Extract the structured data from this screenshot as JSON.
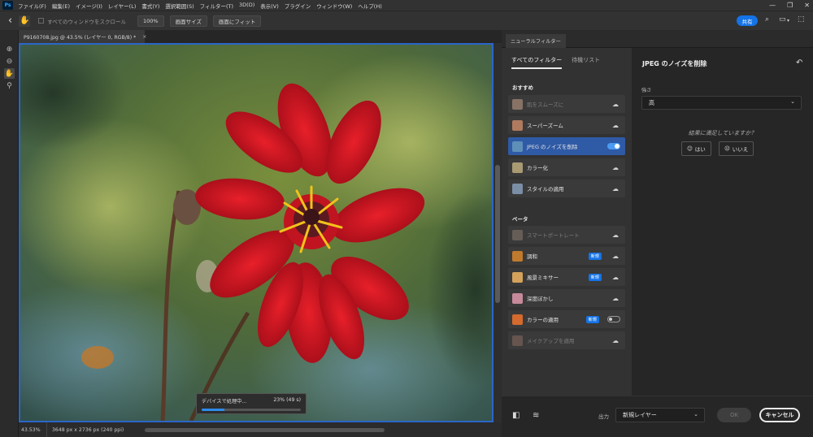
{
  "app": {
    "logo": "Ps"
  },
  "menu": [
    "ファイル(F)",
    "編集(E)",
    "イメージ(I)",
    "レイヤー(L)",
    "書式(Y)",
    "選択範囲(S)",
    "フィルター(T)",
    "3D(D)",
    "表示(V)",
    "プラグイン",
    "ウィンドウ(W)",
    "ヘルプ(H)"
  ],
  "window_controls": {
    "minimize": "—",
    "restore": "❐",
    "close": "✕"
  },
  "options": {
    "back_icon": "chevron-left-icon",
    "scroll_all_label": "すべてのウィンドウをスクロール",
    "zoom_100": "100%",
    "fit_screen": "画面サイズ",
    "fill_screen": "画面にフィット",
    "share": "共有"
  },
  "document": {
    "tab_title": "P9160708.jpg @ 43.5% (レイヤー 0, RGB/8) *",
    "tab_close": "×",
    "zoom": "43.53%",
    "size_info": "3648 px x 2736 px (240 ppi)"
  },
  "progress": {
    "label": "デバイスで処理中...",
    "value_text": "23% (49 s)",
    "percent": 23
  },
  "neural_filters": {
    "panel_tab": "ニューラルフィルター",
    "tabs": [
      "すべてのフィルター",
      "待機リスト"
    ],
    "section_featured": "おすすめ",
    "section_beta": "ベータ",
    "featured": [
      {
        "label": "肌をスムーズに",
        "state": "cloud",
        "dim": true,
        "thumb": "#c9a08a"
      },
      {
        "label": "スーパーズーム",
        "state": "cloud",
        "dim": false,
        "thumb": "#b07a5e"
      },
      {
        "label": "JPEG のノイズを削除",
        "state": "on",
        "dim": false,
        "thumb": "#5e8fb8"
      },
      {
        "label": "カラー化",
        "state": "cloud",
        "dim": false,
        "thumb": "#a89a72"
      },
      {
        "label": "スタイルの適用",
        "state": "cloud",
        "dim": false,
        "thumb": "#7a8ea6"
      }
    ],
    "beta": [
      {
        "label": "スマートポートレート",
        "state": "cloud",
        "dim": true,
        "badge": "",
        "thumb": "#8a7a6e"
      },
      {
        "label": "調和",
        "state": "cloud",
        "dim": false,
        "badge": "新規",
        "thumb": "#c07a2e"
      },
      {
        "label": "風景ミキサー",
        "state": "cloud",
        "dim": false,
        "badge": "新規",
        "thumb": "#d4a25a"
      },
      {
        "label": "深度ぼかし",
        "state": "cloud",
        "dim": false,
        "badge": "",
        "thumb": "#c68a9a"
      },
      {
        "label": "カラーの適用",
        "state": "off",
        "dim": false,
        "badge": "新規",
        "thumb": "#d46a2e"
      },
      {
        "label": "メイクアップを適用",
        "state": "cloud",
        "dim": true,
        "badge": "",
        "thumb": "#8a6a5e"
      }
    ],
    "detail": {
      "title": "JPEG のノイズを削除",
      "strength_label": "強さ",
      "strength_value": "高",
      "satisfied_question": "結果に満足していますか？",
      "yes": "はい",
      "no": "いいえ"
    },
    "bottom": {
      "output_label": "出力",
      "output_value": "新規レイヤー",
      "ok": "OK",
      "cancel": "キャンセル"
    }
  },
  "colors": {
    "accent": "#1473e6",
    "selected_row": "#2f5aa6",
    "canvas_border": "#2a66c8"
  }
}
